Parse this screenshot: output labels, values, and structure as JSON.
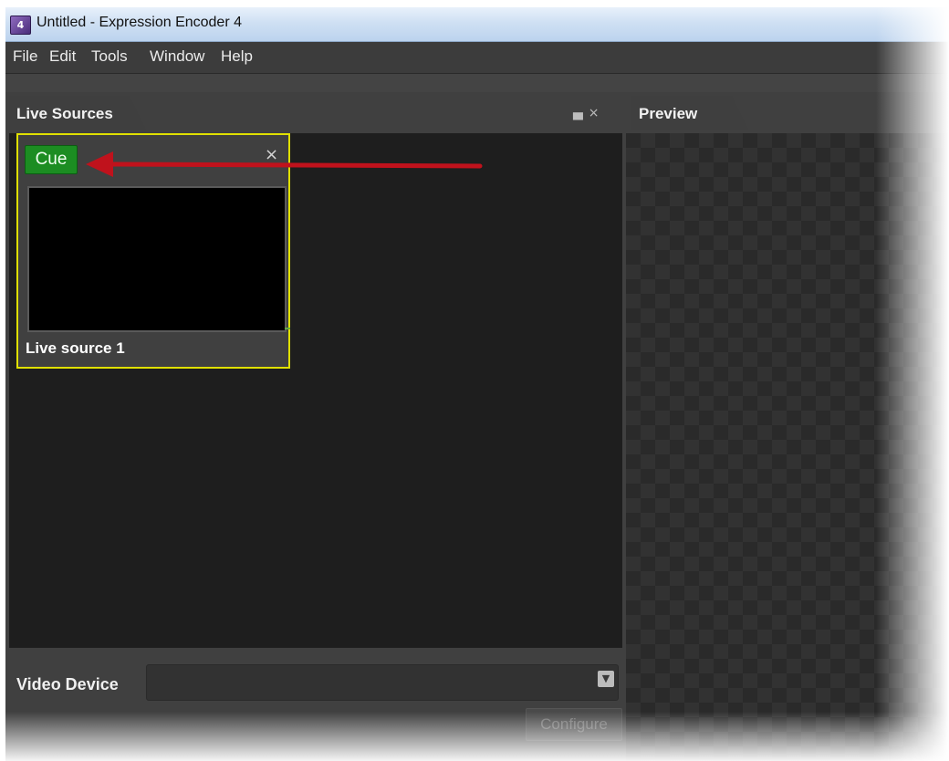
{
  "window": {
    "title": "Untitled - Expression Encoder 4",
    "icon_label": "4"
  },
  "menu": {
    "items": [
      "File",
      "Edit",
      "Tools",
      "Window",
      "Help"
    ]
  },
  "live_sources": {
    "tab_label": "Live Sources",
    "source": {
      "cue_label": "Cue",
      "name": "Live source 1"
    }
  },
  "preview": {
    "tab_label": "Preview"
  },
  "device": {
    "label": "Video Device",
    "selected_value": "",
    "configure_label": "Configure"
  },
  "colors": {
    "cue_green": "#1c8d22",
    "selection_yellow": "#e0e000",
    "arrow_red": "#c0121c"
  },
  "icons": [
    "app-icon",
    "pin-icon",
    "close-icon",
    "card-close-icon",
    "chevron-down-icon",
    "annotation-arrow"
  ]
}
